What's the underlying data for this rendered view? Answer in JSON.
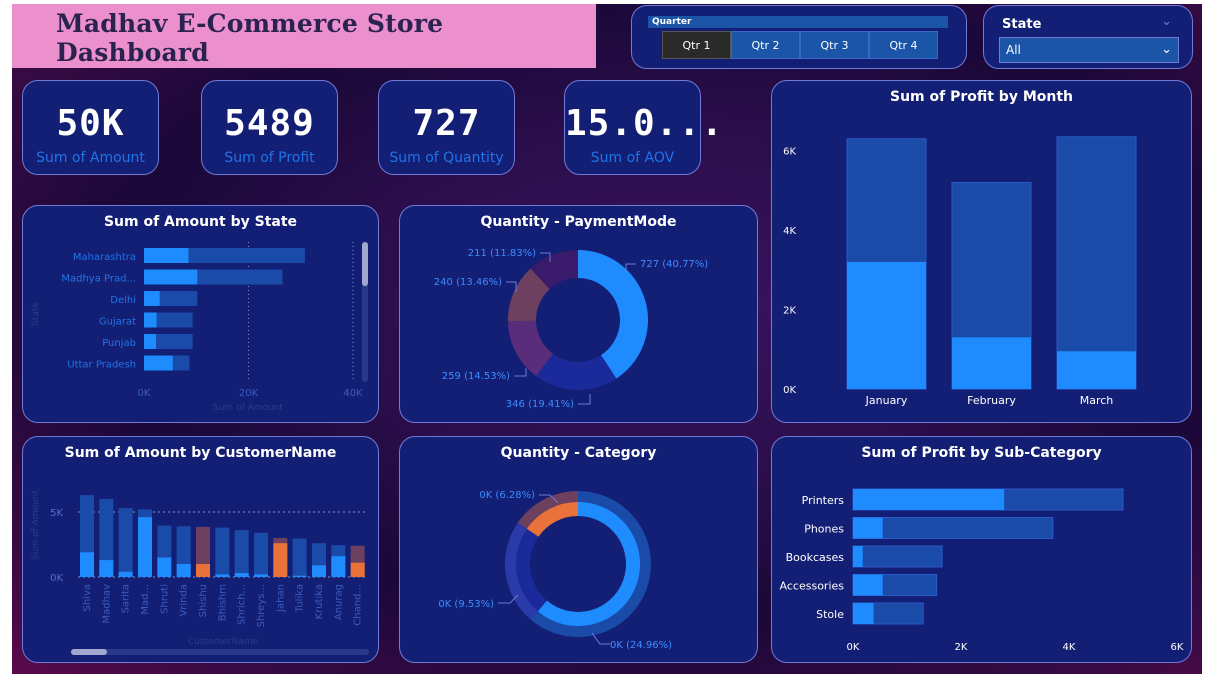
{
  "header": {
    "title": "Madhav E-Commerce Store Dashboard"
  },
  "quarter_slicer": {
    "title": "Quarter",
    "options": [
      "Qtr 1",
      "Qtr 2",
      "Qtr 3",
      "Qtr 4"
    ],
    "selected": "Qtr 1"
  },
  "state_slicer": {
    "label": "State",
    "value": "All"
  },
  "kpis": [
    {
      "value": "50K",
      "label": "Sum of Amount"
    },
    {
      "value": "5489",
      "label": "Sum of Profit"
    },
    {
      "value": "727",
      "label": "Sum of Quantity"
    },
    {
      "value": "15.0...",
      "label": "Sum of AOV"
    }
  ],
  "colors": {
    "highlight": "#1e8cff",
    "base": "#1a4ba8",
    "orange": "#e8723a",
    "maroon": "#6e4060",
    "purple": "#5a2d7a",
    "navy": "#1a2a9a",
    "card": "#131f74"
  },
  "chart_data": [
    {
      "id": "amount-by-state",
      "type": "bar",
      "orientation": "horizontal",
      "title": "Sum of Amount by State",
      "xlabel": "Sum of Amount",
      "ylabel": "State",
      "categories": [
        "Maharashtra",
        "Madhya Prad...",
        "Delhi",
        "Gujarat",
        "Punjab",
        "Uttar Pradesh"
      ],
      "series": [
        {
          "values": [
            30800,
            26500,
            10200,
            9300,
            9300,
            8700
          ]
        },
        {
          "values": [
            8500,
            10200,
            3000,
            2400,
            2300,
            5500
          ]
        }
      ],
      "xticks": [
        "0K",
        "20K",
        "40K"
      ],
      "xlim": [
        0,
        40000
      ]
    },
    {
      "id": "quantity-paymentmode",
      "type": "pie",
      "donut": true,
      "title": "Quantity - PaymentMode",
      "slices": [
        {
          "value": 727,
          "label": "727 (40.77%)"
        },
        {
          "value": 346,
          "label": "346 (19.41%)"
        },
        {
          "value": 259,
          "label": "259 (14.53%)"
        },
        {
          "value": 240,
          "label": "240 (13.46%)"
        },
        {
          "value": 211,
          "label": "211 (11.83%)"
        }
      ]
    },
    {
      "id": "profit-by-month",
      "type": "bar",
      "title": "Sum of Profit by Month",
      "categories": [
        "January",
        "February",
        "March"
      ],
      "series": [
        {
          "values": [
            6300,
            5200,
            6350
          ]
        },
        {
          "values": [
            3200,
            1300,
            950
          ]
        }
      ],
      "yticks": [
        "0K",
        "2K",
        "4K",
        "6K"
      ],
      "ylim": [
        0,
        7000
      ]
    },
    {
      "id": "amount-by-customer",
      "type": "bar",
      "title": "Sum of Amount by CustomerName",
      "xlabel": "CustomerName",
      "ylabel": "Sum of Amount",
      "categories": [
        "Shiva",
        "Madhav",
        "Sarita",
        "Mad...",
        "Shruti",
        "Vrinda",
        "Shishu",
        "Bhishm",
        "Shrich...",
        "Shreys...",
        "Jahan",
        "Tulika",
        "Krutika",
        "Anurag",
        "Chand..."
      ],
      "series": [
        {
          "values": [
            6300,
            6000,
            5300,
            5200,
            3950,
            3900,
            3850,
            3800,
            3600,
            3400,
            3000,
            2950,
            2600,
            2450,
            2400
          ]
        },
        {
          "values": [
            1900,
            1300,
            400,
            4600,
            1500,
            1000,
            1000,
            200,
            300,
            200,
            2600,
            100,
            900,
            1600,
            1100
          ]
        }
      ],
      "highlight_colors": [
        "#1e8cff",
        "#1e8cff",
        "#1e8cff",
        "#1e8cff",
        "#1e8cff",
        "#1e8cff",
        "#e8723a",
        "#1e8cff",
        "#1e8cff",
        "#1e8cff",
        "#e8723a",
        "#1e8cff",
        "#1e8cff",
        "#1e8cff",
        "#e8723a"
      ],
      "base_colors": [
        "#1a4ba8",
        "#1a4ba8",
        "#1a4ba8",
        "#1a4ba8",
        "#1a4ba8",
        "#1a4ba8",
        "#6e4060",
        "#1a4ba8",
        "#1a4ba8",
        "#1a4ba8",
        "#6e4060",
        "#1a4ba8",
        "#1a4ba8",
        "#1a4ba8",
        "#6e4060"
      ],
      "yticks": [
        "0K",
        "5K"
      ],
      "ylim": [
        0,
        7000
      ]
    },
    {
      "id": "quantity-category",
      "type": "pie",
      "donut": true,
      "title": "Quantity - Category",
      "slices": [
        {
          "value": 24.96,
          "label": "0K (24.96%)"
        },
        {
          "value": 9.53,
          "label": "0K (9.53%)"
        },
        {
          "value": 6.28,
          "label": "0K (6.28%)"
        }
      ]
    },
    {
      "id": "profit-by-subcategory",
      "type": "bar",
      "orientation": "horizontal",
      "title": "Sum of Profit by Sub-Category",
      "categories": [
        "Printers",
        "Phones",
        "Bookcases",
        "Accessories",
        "Stole"
      ],
      "series": [
        {
          "values": [
            5000,
            3700,
            1650,
            1550,
            1300
          ]
        },
        {
          "values": [
            2800,
            550,
            180,
            550,
            380
          ]
        }
      ],
      "xticks": [
        "0K",
        "2K",
        "4K",
        "6K"
      ],
      "xlim": [
        0,
        6000
      ]
    }
  ]
}
